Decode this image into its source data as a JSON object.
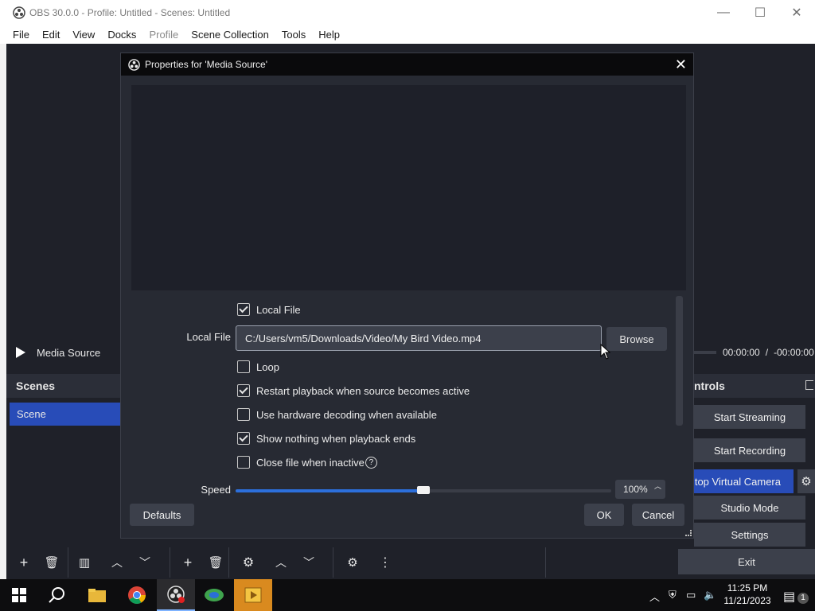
{
  "window": {
    "title": "OBS 30.0.0 - Profile: Untitled - Scenes: Untitled",
    "minimize": "—",
    "maximize": "☐",
    "close": "✕"
  },
  "menu": [
    "File",
    "Edit",
    "View",
    "Docks",
    "Profile",
    "Scene Collection",
    "Tools",
    "Help"
  ],
  "background": {
    "source_label": "Media Source",
    "time_current": "00:00:00",
    "time_sep": "/",
    "time_remaining": "-00:00:00",
    "scenes_header": "Scenes",
    "scene_item": "Scene",
    "controls_header": "ntrols",
    "controls": {
      "start_streaming": "Start Streaming",
      "start_recording": "Start Recording",
      "virtual_camera": "top Virtual Camera",
      "studio_mode": "Studio Mode",
      "settings": "Settings",
      "exit": "Exit"
    }
  },
  "dialog": {
    "title": "Properties for 'Media Source'",
    "local_file_checkbox": {
      "label": "Local File",
      "checked": true
    },
    "local_file_label": "Local File",
    "local_file_value": "C:/Users/vm5/Downloads/Video/My Bird Video.mp4",
    "browse": "Browse",
    "options": [
      {
        "label": "Loop",
        "checked": false
      },
      {
        "label": "Restart playback when source becomes active",
        "checked": true
      },
      {
        "label": "Use hardware decoding when available",
        "checked": false
      },
      {
        "label": "Show nothing when playback ends",
        "checked": true
      },
      {
        "label": "Close file when inactive",
        "checked": false
      }
    ],
    "help_icon": "?",
    "speed_label": "Speed",
    "speed_value": "100%",
    "speed_fraction": 0.5,
    "defaults": "Defaults",
    "ok": "OK",
    "cancel": "Cancel"
  },
  "taskbar": {
    "time": "11:25 PM",
    "date": "11/21/2023",
    "notification_count": "1"
  }
}
